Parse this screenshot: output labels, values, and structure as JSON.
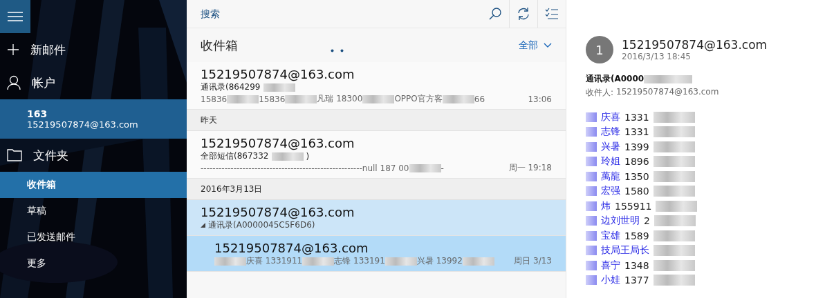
{
  "sidebar": {
    "items": [
      {
        "kind": "compose",
        "label": "新邮件"
      },
      {
        "kind": "accounts",
        "label": "帐户"
      },
      {
        "kind": "account",
        "name": "163",
        "email": "15219507874@163.com",
        "selected": true
      },
      {
        "kind": "folders",
        "label": "文件夹"
      },
      {
        "kind": "folder",
        "label": "收件箱",
        "selected": true
      },
      {
        "kind": "folder",
        "label": "草稿",
        "selected": false
      },
      {
        "kind": "folder",
        "label": "已发送邮件",
        "selected": false
      },
      {
        "kind": "folder",
        "label": "更多",
        "selected": false
      }
    ]
  },
  "list": {
    "search": {
      "placeholder": "搜索"
    },
    "title": "收件箱",
    "filter": "全部",
    "loading": true,
    "entries": [
      {
        "kind": "message",
        "sender": "15219507874@163.com",
        "subject": [
          {
            "kind": "text",
            "text": "通讯录(864299"
          },
          {
            "kind": "blur"
          }
        ],
        "preview": [
          {
            "kind": "text",
            "text": "15836"
          },
          {
            "kind": "blur"
          },
          {
            "kind": "text",
            "text": " 15836"
          },
          {
            "kind": "blur"
          },
          {
            "kind": "text",
            "text": "凡瑞 18300"
          },
          {
            "kind": "blur"
          },
          {
            "kind": "text",
            "text": " OPPO官方客"
          },
          {
            "kind": "blur"
          },
          {
            "kind": "text",
            "text": " 66"
          }
        ],
        "time": "13:06",
        "selected": false,
        "child": false
      },
      {
        "kind": "group",
        "label": "昨天"
      },
      {
        "kind": "message",
        "sender": "15219507874@163.com",
        "subject": [
          {
            "kind": "text",
            "text": "全部短信(867332"
          },
          {
            "kind": "blur"
          },
          {
            "kind": "text",
            "text": ")"
          }
        ],
        "preview": [
          {
            "kind": "text",
            "text": "------------------------------------------------------null 187 00"
          },
          {
            "kind": "blur"
          },
          {
            "kind": "text",
            "text": "-"
          }
        ],
        "time": "周一 19:18",
        "selected": false,
        "child": false
      },
      {
        "kind": "group",
        "label": "2016年3月13日"
      },
      {
        "kind": "conversation",
        "sender": "15219507874@163.com",
        "subject": "通讯录(A0000045C5F6D6)",
        "expanded": true,
        "selected": true
      },
      {
        "kind": "message",
        "sender": "15219507874@163.com",
        "preview": [
          {
            "kind": "blur"
          },
          {
            "kind": "text",
            "text": "庆喜 1331911"
          },
          {
            "kind": "blur"
          },
          {
            "kind": "text",
            "text": "志锋 133191"
          },
          {
            "kind": "blur"
          },
          {
            "kind": "text",
            "text": "兴暑 13992"
          },
          {
            "kind": "blur"
          }
        ],
        "time": "周日 3/13",
        "selected": true,
        "child": true
      }
    ]
  },
  "reading": {
    "avatar": "1",
    "sender": "15219507874@163.com",
    "date": "2016/3/13 18:45",
    "subject": "通讯录(A0000",
    "recipient_label": "收件人:",
    "recipient": "15219507874@163.com",
    "contacts": [
      {
        "name": "庆喜",
        "number": "1331"
      },
      {
        "name": "志锋",
        "number": "1331"
      },
      {
        "name": "兴暑",
        "number": "1399"
      },
      {
        "name": "玲姐",
        "number": "1896"
      },
      {
        "name": "萬龍",
        "number": "1350"
      },
      {
        "name": "宏强",
        "number": "1580"
      },
      {
        "name": "炜",
        "number": "155911"
      },
      {
        "name": "边刘世明",
        "number": "2"
      },
      {
        "name": "宝雄",
        "number": "1589"
      },
      {
        "name": "技局王局长"
      },
      {
        "name": "喜宁",
        "number": "1348"
      },
      {
        "name": "小娃",
        "number": "1377"
      }
    ]
  }
}
